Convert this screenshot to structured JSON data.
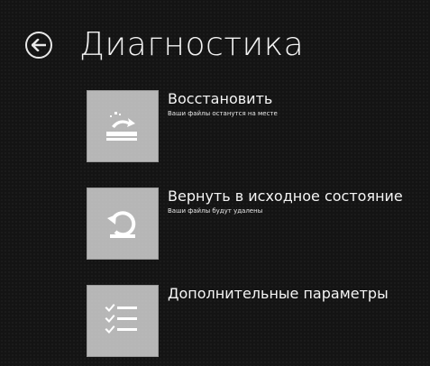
{
  "header": {
    "title": "Диагностика",
    "back_icon": "back-arrow-circle-icon"
  },
  "options": [
    {
      "title": "Восстановить",
      "description": "Ваши файлы останутся на месте",
      "icon": "refresh-icon"
    },
    {
      "title": "Вернуть в исходное состояние",
      "description": "Ваши файлы будут удалены",
      "icon": "reset-icon"
    },
    {
      "title": "Дополнительные параметры",
      "description": "",
      "icon": "checklist-icon"
    }
  ],
  "colors": {
    "background": "#141414",
    "tile": "#b6b6b6",
    "text": "#f4f4f4"
  }
}
